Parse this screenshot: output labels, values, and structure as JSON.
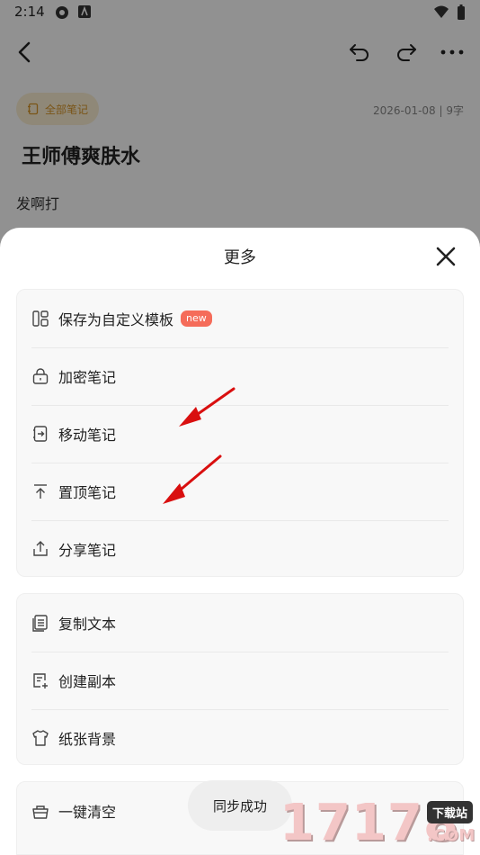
{
  "status_bar": {
    "time": "2:14"
  },
  "note": {
    "folder": "全部笔记",
    "meta": "2026-01-08 | 9字",
    "title": "王师傅爽肤水",
    "body": "发啊打"
  },
  "sheet": {
    "title": "更多",
    "group1": [
      {
        "label": "保存为自定义模板",
        "badge": "new",
        "icon": "template-icon"
      },
      {
        "label": "加密笔记",
        "icon": "lock-icon"
      },
      {
        "label": "移动笔记",
        "icon": "move-icon"
      },
      {
        "label": "置顶笔记",
        "icon": "pin-top-icon"
      },
      {
        "label": "分享笔记",
        "icon": "share-icon"
      }
    ],
    "group2": [
      {
        "label": "复制文本",
        "icon": "copy-icon"
      },
      {
        "label": "创建副本",
        "icon": "duplicate-icon"
      },
      {
        "label": "纸张背景",
        "icon": "shirt-icon"
      }
    ],
    "group3": [
      {
        "label": "一键清空",
        "icon": "clear-basket-icon"
      }
    ]
  },
  "toast": "同步成功",
  "watermark": {
    "digits": "17178",
    "tag": "下载站",
    "suffix": ".COM"
  },
  "colors": {
    "accent_folder": "#d7962a",
    "badge": "#f56c5a",
    "arrow": "#d90f0f"
  }
}
